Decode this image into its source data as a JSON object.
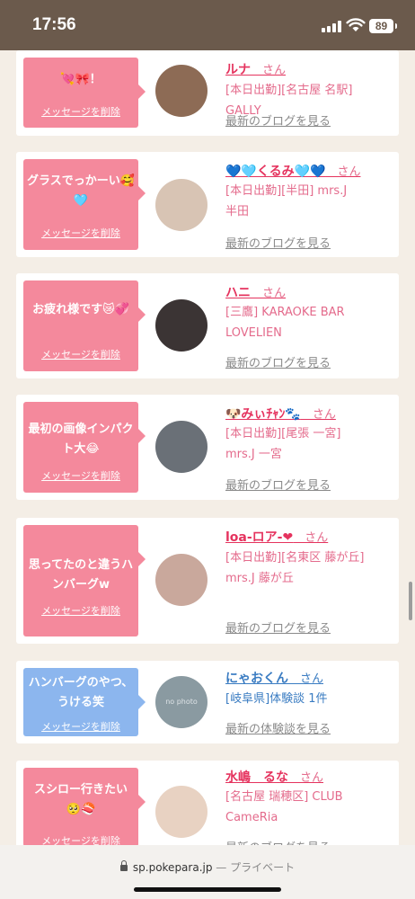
{
  "status_bar": {
    "time": "17:56",
    "battery": "89"
  },
  "cards": [
    {
      "message": "💘🎀！",
      "delete_label": "メッセージを削除",
      "name": "ルナ",
      "san": "　さん",
      "info": "[本日出勤][名古屋 名駅] GALLY",
      "blog_label": "最新のブログを見る",
      "avatar_color": "#8d6b55"
    },
    {
      "message": "グラスでっかーい🥰🩵",
      "delete_label": "メッセージを削除",
      "name": "💙🩵くるみ🩵💙",
      "san": "　さん",
      "info": "[本日出勤][半田] mrs.J 半田",
      "blog_label": "最新のブログを見る",
      "avatar_color": "#d8c4b4"
    },
    {
      "message": "お疲れ様です😿💞",
      "delete_label": "メッセージを削除",
      "name": "ハニ",
      "san": "　さん",
      "info": "[三鷹] KARAOKE BAR LOVELIEN",
      "blog_label": "最新のブログを見る",
      "avatar_color": "#3b3434"
    },
    {
      "message": "最初の画像インパクト大😂",
      "delete_label": "メッセージを削除",
      "name": "🐶みぃﾁｬﾝ🐾",
      "san": "　さん",
      "info": "[本日出勤][尾張 一宮] mrs.J 一宮",
      "blog_label": "最新のブログを見る",
      "avatar_color": "#6a7077"
    },
    {
      "message": "思ってたのと違うハンバーグw",
      "delete_label": "メッセージを削除",
      "name": "loa-ロア-❤",
      "san": "　さん",
      "info": "[本日出勤][名東区 藤が丘] mrs.J 藤が丘",
      "blog_label": "最新のブログを見る",
      "avatar_color": "#c9a89c"
    },
    {
      "message": "ハンバーグのやつ、うける笑",
      "delete_label": "メッセージを削除",
      "name": "にゃおくん",
      "san": "　さん",
      "info": "[岐阜県]体験談 1件",
      "blog_label": "最新の体験談を見る",
      "avatar_color": "#8a9aa1",
      "avatar_text": "no photo"
    },
    {
      "message": "スシロー行きたい🥺🍣",
      "delete_label": "メッセージを削除",
      "name": "水嶋　るな",
      "san": "　さん",
      "info": "[名古屋 瑞穂区] CLUB CameRia",
      "blog_label": "最新のブログを見る",
      "avatar_color": "#e8d2c2"
    }
  ],
  "address_bar": {
    "url": "sp.pokepara.jp",
    "mode": " — プライベート"
  },
  "colors": {
    "pink_bubble": "#f4899c",
    "blue_bubble": "#8cb6ee",
    "name_pink": "#e5335e",
    "name_blue": "#3a7cc2",
    "status_bar": "#6b5a4c"
  }
}
